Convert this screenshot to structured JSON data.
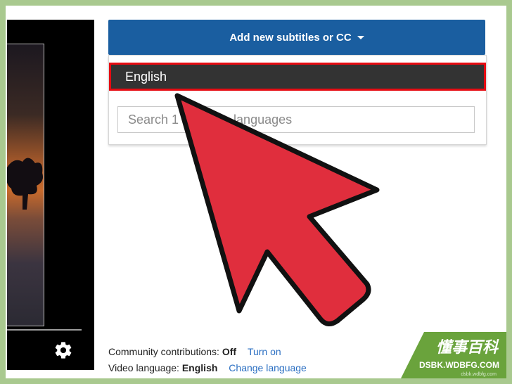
{
  "subtitles": {
    "add_button_label": "Add new subtitles or CC",
    "selected_language": "English",
    "search_placeholder": "Search 1",
    "search_suffix": "languages"
  },
  "footer": {
    "community_label": "Community contributions:",
    "community_value": "Off",
    "community_link": "Turn on",
    "video_language_label": "Video language:",
    "video_language_value": "English",
    "change_language_link": "Change language"
  },
  "watermark": {
    "title": "懂事百科",
    "url": "DSBK.WDBFG.COM",
    "small": "dsbk.wdbfg.com"
  },
  "colors": {
    "header_blue": "#1a5ea0",
    "highlight_red": "#e60b12",
    "arrow_red": "#e02e3d",
    "link_blue": "#2b6fc2",
    "watermark_green": "#6aa33c"
  }
}
